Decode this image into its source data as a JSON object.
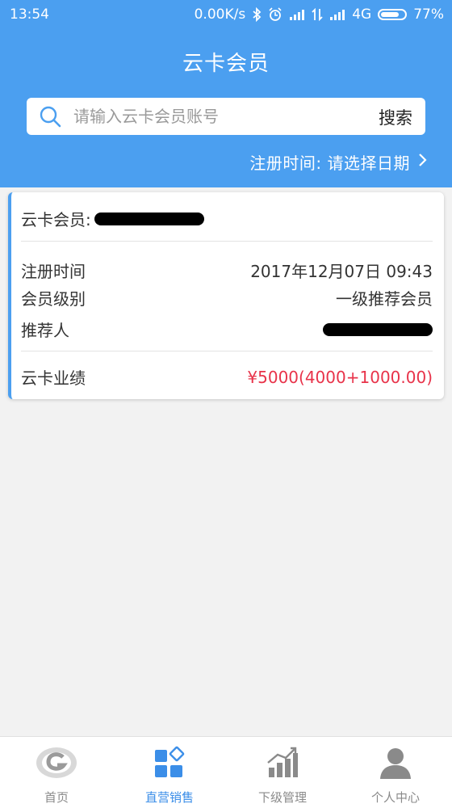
{
  "status_bar": {
    "time": "13:54",
    "net_speed": "0.00K/s",
    "network": "4G",
    "battery": "77%",
    "battery_level": 0.77
  },
  "header": {
    "title": "云卡会员"
  },
  "search": {
    "placeholder": "请输入云卡会员账号",
    "value": "",
    "button_label": "搜索"
  },
  "date_filter": {
    "label": "注册时间: 请选择日期"
  },
  "member_card": {
    "member_label": "云卡会员:",
    "reg_time_label": "注册时间",
    "reg_time_value": "2017年12月07日 09:43",
    "level_label": "会员级别",
    "level_value": "一级推荐会员",
    "referrer_label": "推荐人",
    "performance_label": "云卡业绩",
    "performance_value": "¥5000(4000+1000.00)"
  },
  "tabbar": {
    "items": [
      {
        "label": "首页",
        "icon": "home-logo-icon",
        "active": false
      },
      {
        "label": "直营销售",
        "icon": "grid-apps-icon",
        "active": true
      },
      {
        "label": "下级管理",
        "icon": "bar-chart-icon",
        "active": false
      },
      {
        "label": "个人中心",
        "icon": "user-icon",
        "active": false
      }
    ]
  },
  "colors": {
    "primary": "#4b9ff0",
    "accent_red": "#e8334a",
    "tab_active": "#3b8ee8",
    "tab_inactive": "#8a8a8a"
  }
}
